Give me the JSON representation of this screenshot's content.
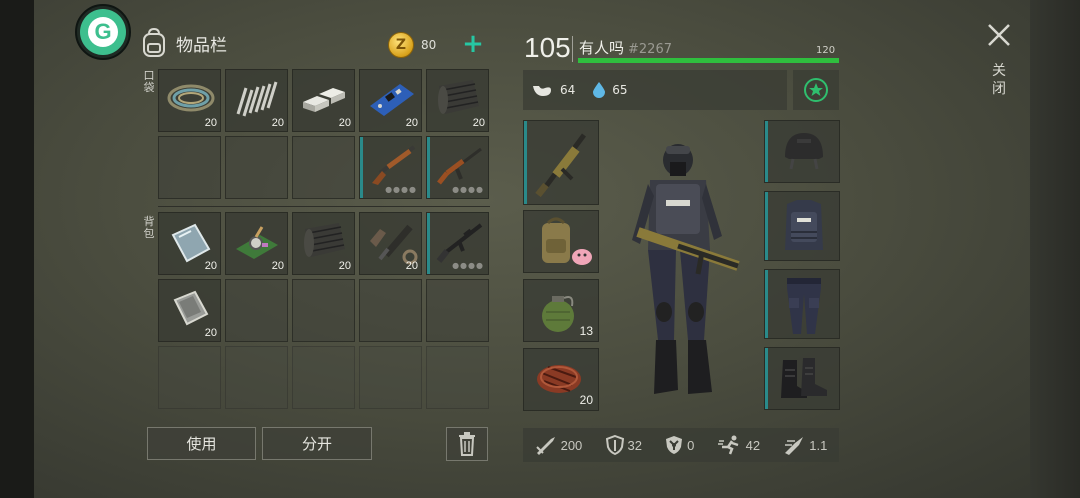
{
  "app": {
    "logo_letter": "G"
  },
  "inventory": {
    "title": "物品栏",
    "coins": "80",
    "pocket_label_chars": [
      "口",
      "袋"
    ],
    "backpack_label_chars": [
      "背",
      "包"
    ],
    "pocket_slots": [
      {
        "item": "rope-coil",
        "qty": "20"
      },
      {
        "item": "spring",
        "qty": "20"
      },
      {
        "item": "metal-ingots",
        "qty": "20"
      },
      {
        "item": "circuit-board",
        "qty": "20"
      },
      {
        "item": "fabric-roll",
        "qty": "20"
      },
      {
        "item": "",
        "qty": ""
      },
      {
        "item": "",
        "qty": ""
      },
      {
        "item": "",
        "qty": ""
      },
      {
        "item": "shotgun",
        "qty": ""
      },
      {
        "item": "assault-rifle",
        "qty": ""
      }
    ],
    "backpack_slots": [
      {
        "item": "glass-plate",
        "qty": "20"
      },
      {
        "item": "electronic-chip",
        "qty": "20"
      },
      {
        "item": "fabric-roll",
        "qty": "20"
      },
      {
        "item": "weapon-parts",
        "qty": "20"
      },
      {
        "item": "rifle-m4",
        "qty": ""
      },
      {
        "item": "steel-plate",
        "qty": "20"
      }
    ],
    "use_button": "使用",
    "split_button": "分开"
  },
  "character": {
    "level": "105",
    "name": "有人吗",
    "id": "#2267",
    "hp_max": "120",
    "hp_fraction": 1.0,
    "food": "64",
    "water": "65",
    "equipment_left": [
      {
        "item": "grenade-launcher-rifle",
        "qty": ""
      },
      {
        "item": "backpack",
        "qty": ""
      },
      {
        "item": "grenade",
        "qty": "13"
      },
      {
        "item": "steak",
        "qty": "20"
      }
    ],
    "equipment_right": [
      "helmet",
      "body-armor",
      "pants",
      "boots"
    ],
    "stats": {
      "attack": "200",
      "defense": "32",
      "radiation": "0",
      "speed": "42",
      "weight": "1.1"
    }
  },
  "close_label_chars": [
    "关",
    "闭"
  ],
  "colors": {
    "accent": "#26c7a3",
    "hp": "#2fbf3e",
    "slot_accent": "#2a8a8a"
  }
}
